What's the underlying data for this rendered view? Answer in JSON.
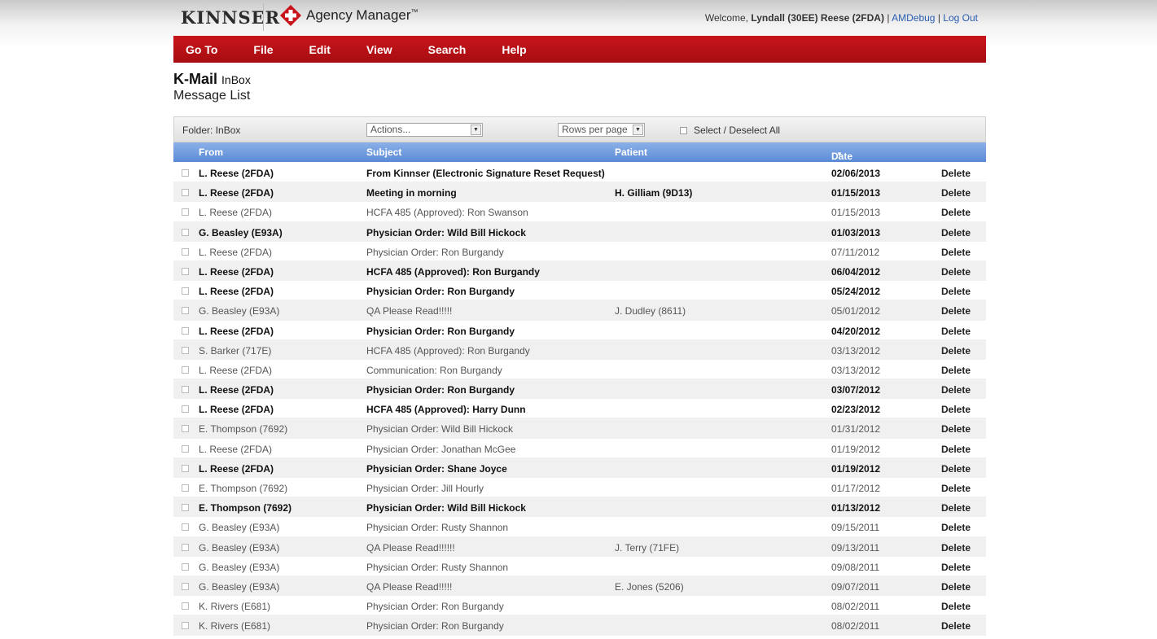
{
  "header": {
    "logo": "KINNSER",
    "app_name": "Agency Manager",
    "trademark": "™",
    "welcome_prefix": "Welcome,",
    "user": "Lyndall (30EE) Reese (2FDA)",
    "separator": "|",
    "debug_link": "AMDebug",
    "logout_link": "Log Out",
    "brand_color": "#b71c1c"
  },
  "menu": [
    "Go To",
    "File",
    "Edit",
    "View",
    "Search",
    "Help"
  ],
  "page": {
    "title": "K-Mail",
    "title_suffix": "InBox",
    "subtitle": "Message List"
  },
  "toolbar": {
    "folder_label": "Folder:",
    "folder_value": "InBox",
    "actions_placeholder": "Actions...",
    "rows_per_page": "Rows per page",
    "select_all": "Select / Deselect All"
  },
  "table": {
    "columns": [
      "From",
      "Subject",
      "Patient",
      "Date"
    ],
    "sort_indicator": "▼",
    "rows": [
      {
        "from": "L. Reese (2FDA)",
        "subject": "From Kinnser (Electronic Signature Reset Request)",
        "patient": "",
        "date": "02/06/2013",
        "action": "Delete",
        "unread": true
      },
      {
        "from": "L. Reese (2FDA)",
        "subject": "Meeting in morning",
        "patient": "H. Gilliam (9D13)",
        "date": "01/15/2013",
        "action": "Delete",
        "unread": true
      },
      {
        "from": "L. Reese (2FDA)",
        "subject": "HCFA 485 (Approved): Ron Swanson",
        "patient": "",
        "date": "01/15/2013",
        "action": "Delete",
        "unread": false
      },
      {
        "from": "G. Beasley (E93A)",
        "subject": "Physician Order: Wild Bill Hickock",
        "patient": "",
        "date": "01/03/2013",
        "action": "Delete",
        "unread": true
      },
      {
        "from": "L. Reese (2FDA)",
        "subject": "Physician Order: Ron Burgandy",
        "patient": "",
        "date": "07/11/2012",
        "action": "Delete",
        "unread": false
      },
      {
        "from": "L. Reese (2FDA)",
        "subject": "HCFA 485 (Approved): Ron Burgandy",
        "patient": "",
        "date": "06/04/2012",
        "action": "Delete",
        "unread": true
      },
      {
        "from": "L. Reese (2FDA)",
        "subject": "Physician Order: Ron Burgandy",
        "patient": "",
        "date": "05/24/2012",
        "action": "Delete",
        "unread": true
      },
      {
        "from": "G. Beasley (E93A)",
        "subject": "QA Please Read!!!!!",
        "patient": "J. Dudley (8611)",
        "date": "05/01/2012",
        "action": "Delete",
        "unread": false
      },
      {
        "from": "L. Reese (2FDA)",
        "subject": "Physician Order: Ron Burgandy",
        "patient": "",
        "date": "04/20/2012",
        "action": "Delete",
        "unread": true
      },
      {
        "from": "S. Barker (717E)",
        "subject": "HCFA 485 (Approved): Ron Burgandy",
        "patient": "",
        "date": "03/13/2012",
        "action": "Delete",
        "unread": false
      },
      {
        "from": "L. Reese (2FDA)",
        "subject": "Communication: Ron Burgandy",
        "patient": "",
        "date": "03/13/2012",
        "action": "Delete",
        "unread": false
      },
      {
        "from": "L. Reese (2FDA)",
        "subject": "Physician Order: Ron Burgandy",
        "patient": "",
        "date": "03/07/2012",
        "action": "Delete",
        "unread": true
      },
      {
        "from": "L. Reese (2FDA)",
        "subject": "HCFA 485 (Approved): Harry Dunn",
        "patient": "",
        "date": "02/23/2012",
        "action": "Delete",
        "unread": true
      },
      {
        "from": "E. Thompson (7692)",
        "subject": "Physician Order: Wild Bill Hickock",
        "patient": "",
        "date": "01/31/2012",
        "action": "Delete",
        "unread": false
      },
      {
        "from": "L. Reese (2FDA)",
        "subject": "Physician Order: Jonathan McGee",
        "patient": "",
        "date": "01/19/2012",
        "action": "Delete",
        "unread": false
      },
      {
        "from": "L. Reese (2FDA)",
        "subject": "Physician Order: Shane Joyce",
        "patient": "",
        "date": "01/19/2012",
        "action": "Delete",
        "unread": true
      },
      {
        "from": "E. Thompson (7692)",
        "subject": "Physician Order: Jill Hourly",
        "patient": "",
        "date": "01/17/2012",
        "action": "Delete",
        "unread": false
      },
      {
        "from": "E. Thompson (7692)",
        "subject": "Physician Order: Wild Bill Hickock",
        "patient": "",
        "date": "01/13/2012",
        "action": "Delete",
        "unread": true
      },
      {
        "from": "G. Beasley (E93A)",
        "subject": "Physician Order: Rusty Shannon",
        "patient": "",
        "date": "09/15/2011",
        "action": "Delete",
        "unread": false
      },
      {
        "from": "G. Beasley (E93A)",
        "subject": "QA Please Read!!!!!!",
        "patient": "J. Terry (71FE)",
        "date": "09/13/2011",
        "action": "Delete",
        "unread": false
      },
      {
        "from": "G. Beasley (E93A)",
        "subject": "Physician Order: Rusty Shannon",
        "patient": "",
        "date": "09/08/2011",
        "action": "Delete",
        "unread": false
      },
      {
        "from": "G. Beasley (E93A)",
        "subject": "QA Please Read!!!!!",
        "patient": "E. Jones (5206)",
        "date": "09/07/2011",
        "action": "Delete",
        "unread": false
      },
      {
        "from": "K. Rivers (E681)",
        "subject": "Physician Order: Ron Burgandy",
        "patient": "",
        "date": "08/02/2011",
        "action": "Delete",
        "unread": false
      },
      {
        "from": "K. Rivers (E681)",
        "subject": "Physician Order: Ron Burgandy",
        "patient": "",
        "date": "08/02/2011",
        "action": "Delete",
        "unread": false
      }
    ]
  }
}
